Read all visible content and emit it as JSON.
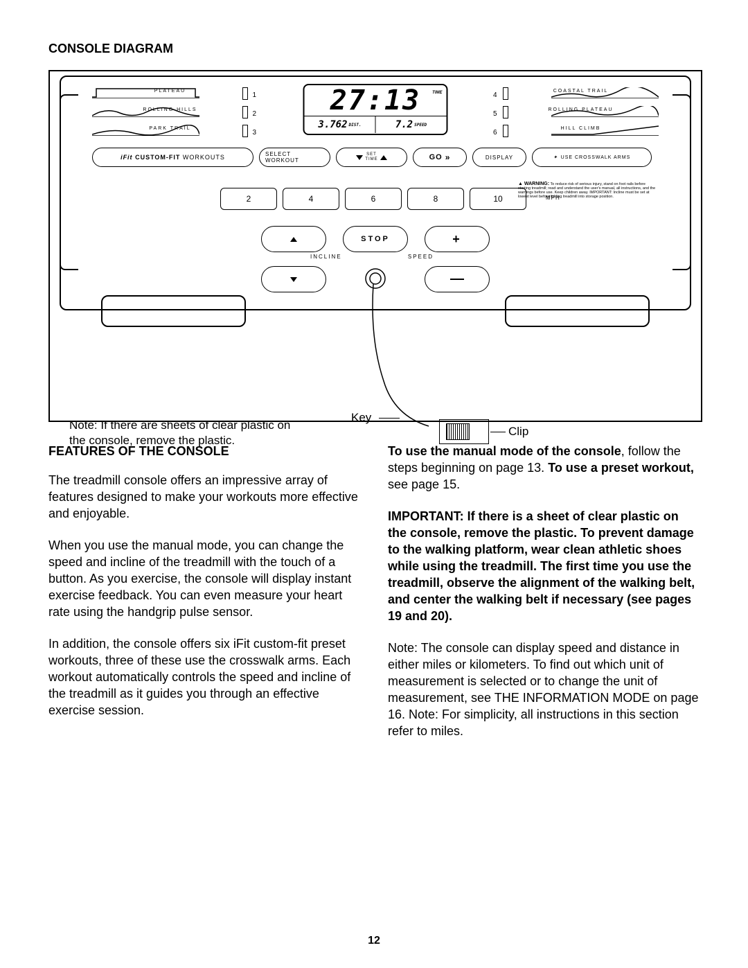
{
  "heading": "CONSOLE DIAGRAM",
  "programs_left": [
    {
      "label": "PLATEAU",
      "num": "1"
    },
    {
      "label": "ROLLING HILLS",
      "num": "2"
    },
    {
      "label": "PARK TRAIL",
      "num": "3"
    }
  ],
  "programs_right": [
    {
      "label": "COASTAL TRAIL",
      "num": "4"
    },
    {
      "label": "ROLLING PLATEAU",
      "num": "5"
    },
    {
      "label": "HILL CLIMB",
      "num": "6"
    }
  ],
  "display": {
    "time": "27:13",
    "time_label": "TIME",
    "distance": "3.762",
    "dist_label": "DIST.",
    "speed": "7.2",
    "speed_label": "SPEED"
  },
  "controls": {
    "custom_fit": "CUSTOM-FIT",
    "workouts": "WORKOUTS",
    "ifit_prefix": "iFit",
    "select": "SELECT WORKOUT",
    "set_time": "SET\nTIME",
    "go": "GO",
    "display": "DISPLAY",
    "arms": "USE CROSSWALK ARMS"
  },
  "speeds": [
    "2",
    "4",
    "6",
    "8",
    "10"
  ],
  "mph": "MPH",
  "warning_label": "WARNING:",
  "warning_text": "To reduce risk of serious injury, stand on foot rails before starting treadmill; read and understand the user's manual, all instructions, and the warnings before use. Keep children away. IMPORTANT: Incline must be set at lowest level before folding treadmill into storage position.",
  "stop": "STOP",
  "incline_label": "INCLINE",
  "speed_label": "SPEED",
  "note": "Note: If there are sheets of clear plastic on the console, remove the plastic.",
  "key_label": "Key",
  "clip_label": "Clip",
  "features_heading": "FEATURES OF THE CONSOLE",
  "para1": "The treadmill console offers an impressive array of features designed to make your workouts more effective and enjoyable.",
  "para2": "When you use the manual mode, you can change the speed and incline of the treadmill with the touch of a button. As you exercise, the console will display instant exercise feedback. You can even measure your heart rate using the handgrip pulse sensor.",
  "para3": "In addition, the console offers six iFit custom-fit preset workouts, three of these use the crosswalk arms. Each workout automatically controls the speed and incline of the treadmill as it guides you through an effective exercise session.",
  "right_p1_a": "To use the manual mode of the console",
  "right_p1_b": ", follow the steps beginning on page 13. ",
  "right_p1_c": "To use a preset workout,",
  "right_p1_d": " see page 15.",
  "right_p2": "IMPORTANT: If there is a sheet of clear plastic on the console, remove the plastic. To prevent damage to the walking platform, wear clean athletic shoes while using the treadmill. The first time you use the treadmill, observe the alignment of the walking belt, and center the walking belt if necessary (see pages 19 and 20).",
  "right_p3": "Note: The console can display speed and distance in either miles or kilometers. To find out which unit of measurement is selected or to change the unit of measurement, see THE INFORMATION MODE on page 16. Note: For simplicity, all instructions in this section refer to miles.",
  "page_number": "12"
}
